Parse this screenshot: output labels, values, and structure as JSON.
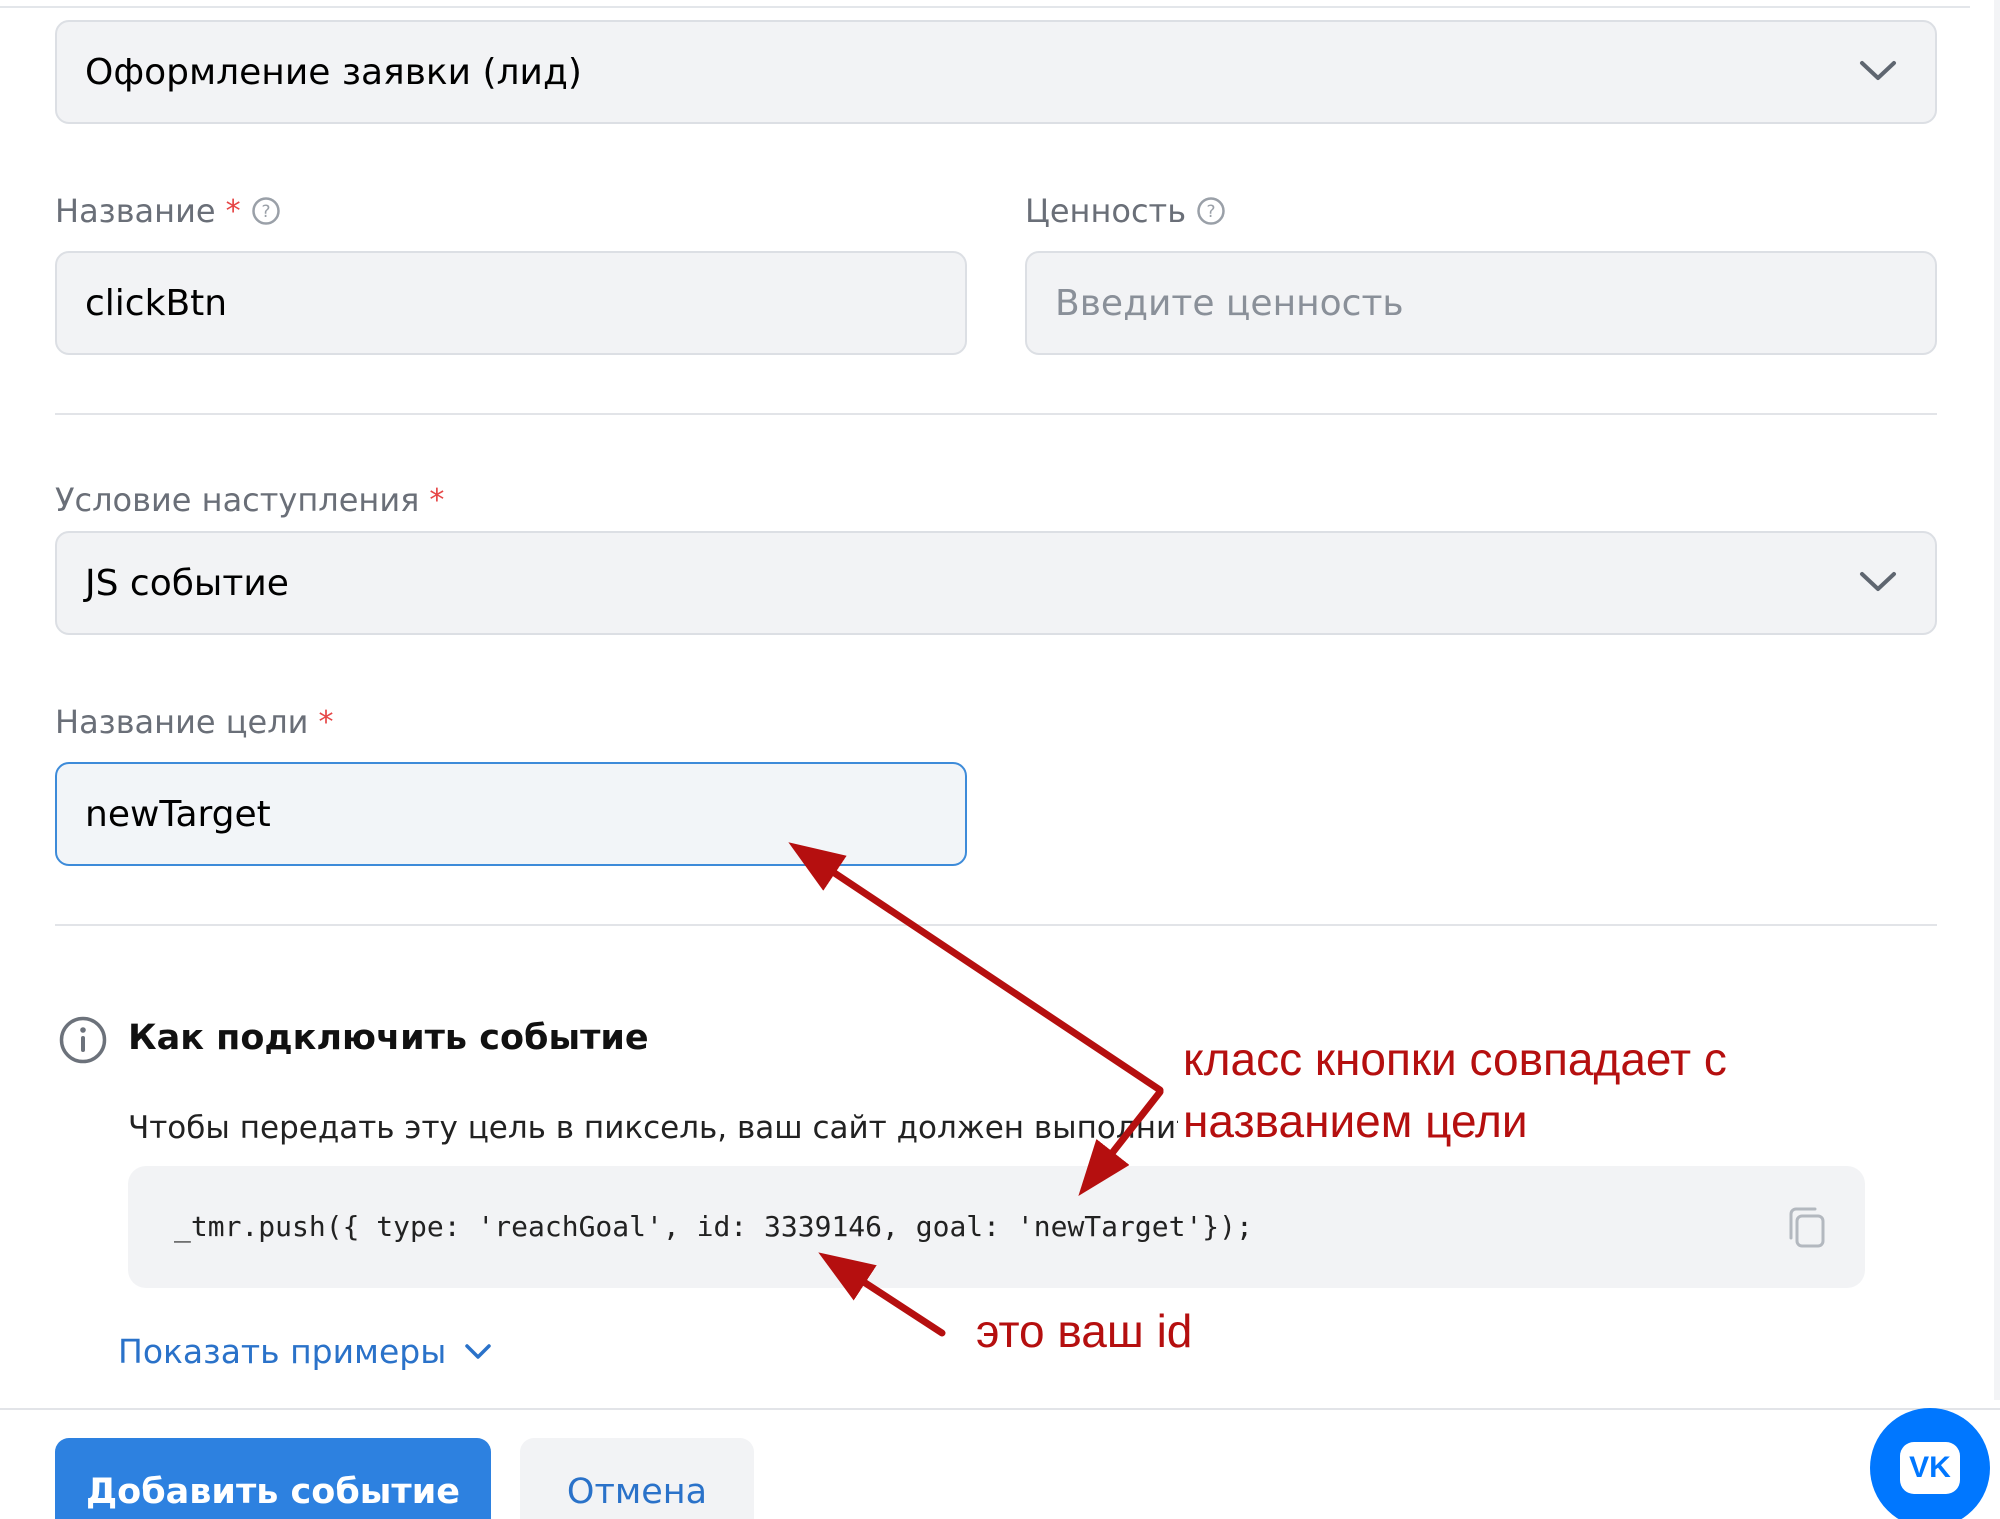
{
  "form": {
    "event_type": {
      "value": "Оформление заявки (лид)"
    },
    "name": {
      "label": "Название",
      "required_mark": "*",
      "value": "clickBtn"
    },
    "value": {
      "label": "Ценность",
      "placeholder": "Введите ценность"
    },
    "condition": {
      "label": "Условие наступления",
      "required_mark": "*",
      "value": "JS событие"
    },
    "goal_name": {
      "label": "Название цели",
      "required_mark": "*",
      "value": "newTarget"
    }
  },
  "howto": {
    "title": "Как подключить событие",
    "description": "Чтобы передать эту цель в пиксель, ваш сайт должен выполнить Ja",
    "code": "_tmr.push({ type: 'reachGoal', id: 3339146, goal: 'newTarget'});",
    "show_examples": "Показать примеры"
  },
  "footer": {
    "add_button": "Добавить событие",
    "cancel_button": "Отмена"
  },
  "fab": {
    "label": "VK"
  },
  "annotations": {
    "goal_match_line1": "класс кнопки совпадает с",
    "goal_match_line2": "названием цели",
    "id_note": "это ваш id"
  },
  "colors": {
    "primary": "#2d81e0",
    "link": "#2a72c9",
    "required": "#e64646",
    "annotation": "#b50f0f",
    "focus": "#3d8bd9"
  }
}
